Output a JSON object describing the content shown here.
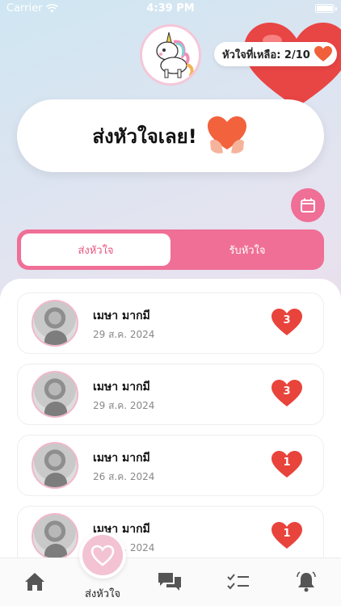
{
  "status_bar": {
    "carrier": "Carrier",
    "time": "4:39 PM"
  },
  "header": {
    "hearts_remaining_label": "หัวใจที่เหลือ: 2/10"
  },
  "send_card": {
    "title": "ส่งหัวใจเลย!"
  },
  "tabs": {
    "send": "ส่งหัวใจ",
    "receive": "รับหัวใจ"
  },
  "list": [
    {
      "name": "เมษา มากมี",
      "date": "29 ส.ค. 2024",
      "count": "3"
    },
    {
      "name": "เมษา มากมี",
      "date": "29 ส.ค. 2024",
      "count": "3"
    },
    {
      "name": "เมษา มากมี",
      "date": "26 ส.ค. 2024",
      "count": "1"
    },
    {
      "name": "เมษา มากมี",
      "date": "26 ส.ค. 2024",
      "count": "1"
    }
  ],
  "bottom_nav": {
    "center_label": "ส่งหัวใจ"
  },
  "colors": {
    "accent": "#ef6f96",
    "heart": "#e8443c",
    "tab_active_text": "#e8557e"
  },
  "icons": [
    "wifi-icon",
    "battery-icon",
    "heart-icon",
    "calendar-icon",
    "home-icon",
    "chat-icon",
    "tasks-icon",
    "bell-icon"
  ]
}
